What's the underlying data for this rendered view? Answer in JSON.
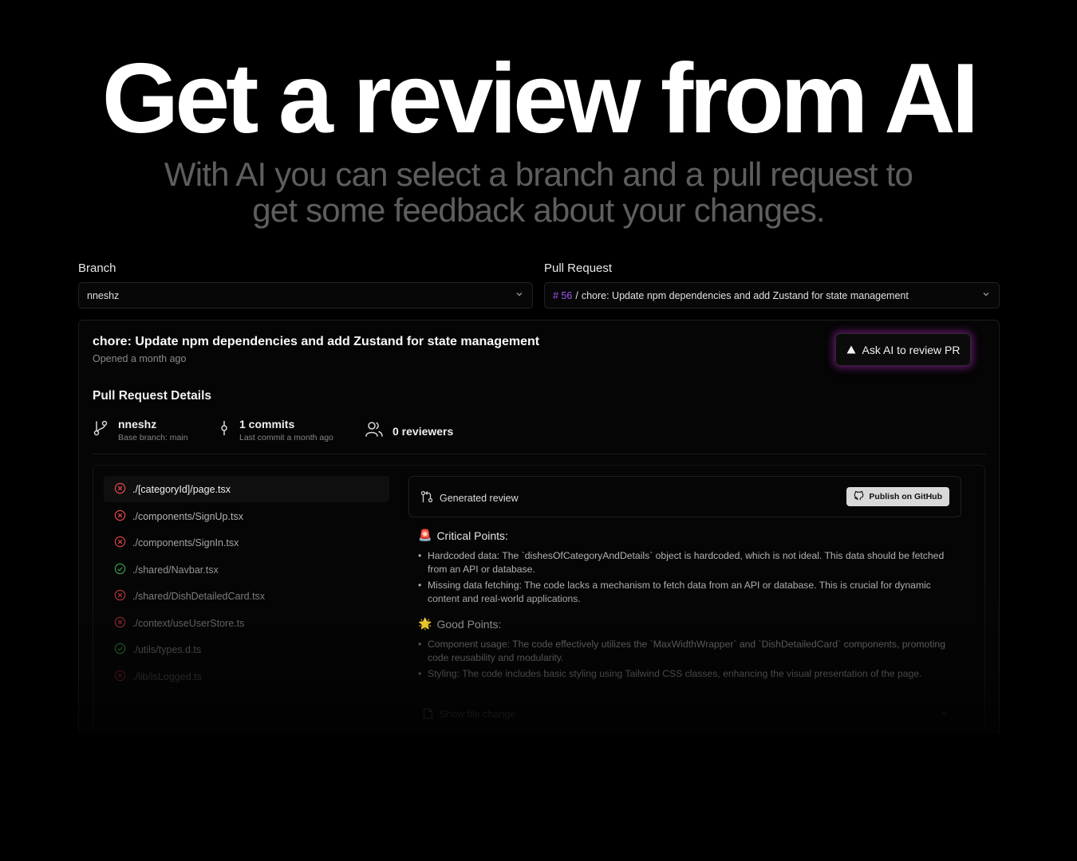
{
  "hero": {
    "title": "Get a review from AI",
    "subtitle": "With AI you can select a branch and a pull request to get some feedback about your changes."
  },
  "branch": {
    "label": "Branch",
    "selected": "nneshz"
  },
  "pull_request": {
    "label": "Pull Request",
    "number": "# 56",
    "separator": "/",
    "selected_title": "chore: Update npm dependencies and add Zustand for state management"
  },
  "pr_card": {
    "title": "chore: Update npm dependencies and add Zustand for state management",
    "opened": "Opened a month ago",
    "ask_button": "Ask AI to review PR"
  },
  "details": {
    "heading": "Pull Request Details",
    "branch_name": "nneshz",
    "base_branch": "Base branch: main",
    "commits": "1 commits",
    "last_commit": "Last commit a month ago",
    "reviewers": "0 reviewers"
  },
  "files": [
    {
      "name": "./[categoryId]/page.tsx",
      "status": "error"
    },
    {
      "name": "./components/SignUp.tsx",
      "status": "error"
    },
    {
      "name": "./components/SignIn.tsx",
      "status": "error"
    },
    {
      "name": "./shared/Navbar.tsx",
      "status": "ok"
    },
    {
      "name": "./shared/DishDetailedCard.tsx",
      "status": "error"
    },
    {
      "name": "./context/useUserStore.ts",
      "status": "error"
    },
    {
      "name": "./utils/types.d.ts",
      "status": "ok"
    },
    {
      "name": "./lib/isLogged.ts",
      "status": "error"
    }
  ],
  "review": {
    "header": "Generated review",
    "publish_button": "Publish on GitHub",
    "critical_title": "Critical Points:",
    "critical_icon": "🚨",
    "critical": [
      "Hardcoded data: The `dishesOfCategoryAndDetails` object is hardcoded, which is not ideal. This data should be fetched from an API or database.",
      "Missing data fetching: The code lacks a mechanism to fetch data from an API or database. This is crucial for dynamic content and real-world applications."
    ],
    "good_title": "Good Points:",
    "good_icon": "🌟",
    "good": [
      "Component usage: The code effectively utilizes the `MaxWidthWrapper` and `DishDetailedCard` components, promoting code reusability and modularity.",
      "Styling: The code includes basic styling using Tailwind CSS classes, enhancing the visual presentation of the page."
    ],
    "show_file_change": "Show file change"
  },
  "colors": {
    "accent_purple": "#9b5cf6",
    "error_red": "#e5484d",
    "ok_green": "#3fb950",
    "glow": "#be28d2"
  }
}
